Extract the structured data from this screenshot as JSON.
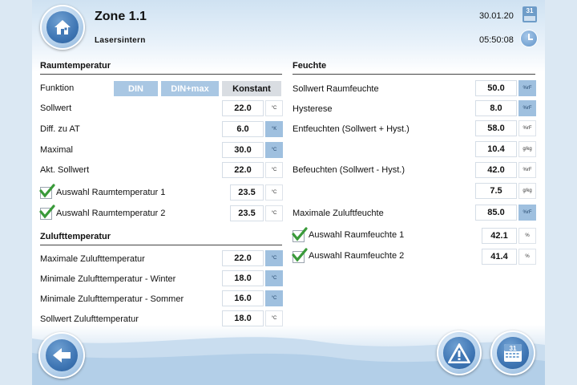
{
  "header": {
    "title": "Zone 1.1",
    "subtitle": "Lasersintern",
    "date": "30.01.20",
    "time": "05:50:08",
    "calendar_day": "31"
  },
  "room_temp": {
    "heading": "Raumtemperatur",
    "function_label": "Funktion",
    "modes": [
      "DIN",
      "DIN+max",
      "Konstant"
    ],
    "active_mode": "Konstant",
    "rows": [
      {
        "label": "Sollwert",
        "value": "22.0",
        "unit": "°C"
      },
      {
        "label": "Diff. zu AT",
        "value": "6.0",
        "unit": "°K"
      },
      {
        "label": "Maximal",
        "value": "30.0",
        "unit": "°C"
      },
      {
        "label": "Akt. Sollwert",
        "value": "22.0",
        "unit": "°C"
      }
    ],
    "selections": [
      {
        "label": "Auswahl Raumtemperatur 1",
        "value": "23.5",
        "unit": "°C",
        "checked": true
      },
      {
        "label": "Auswahl Raumtemperatur 2",
        "value": "23.5",
        "unit": "°C",
        "checked": true
      }
    ]
  },
  "supply_temp": {
    "heading": "Zulufttemperatur",
    "rows": [
      {
        "label": "Maximale Zulufttemperatur",
        "value": "22.0",
        "unit": "°C"
      },
      {
        "label": "Minimale Zulufttemperatur - Winter",
        "value": "18.0",
        "unit": "°C"
      },
      {
        "label": "Minimale Zulufttemperatur - Sommer",
        "value": "16.0",
        "unit": "°C"
      },
      {
        "label": "Sollwert Zulufttemperatur",
        "value": "18.0",
        "unit": "°C"
      }
    ]
  },
  "humidity": {
    "heading": "Feuchte",
    "rows": [
      {
        "label": "Sollwert Raumfeuchte",
        "value": "50.0",
        "unit": "%rF"
      },
      {
        "label": "Hysterese",
        "value": "8.0",
        "unit": "%rF"
      },
      {
        "label": "Entfeuchten (Sollwert + Hyst.)",
        "value": "58.0",
        "unit": "%rF"
      },
      {
        "label": "",
        "value": "10.4",
        "unit": "g/kg"
      },
      {
        "label": "Befeuchten (Sollwert - Hyst.)",
        "value": "42.0",
        "unit": "%rF"
      },
      {
        "label": "",
        "value": "7.5",
        "unit": "g/kg"
      },
      {
        "label": "Maximale Zuluftfeuchte",
        "value": "85.0",
        "unit": "%rF"
      }
    ],
    "selections": [
      {
        "label": "Auswahl Raumfeuchte 1",
        "value": "42.1",
        "unit": "%",
        "checked": true
      },
      {
        "label": "Auswahl Raumfeuchte 2",
        "value": "41.4",
        "unit": "%",
        "checked": true
      }
    ]
  },
  "colors": {
    "accent": "#3f76b4",
    "unit_highlight": "#9fc0df",
    "mode_inactive": "#a9c7e3",
    "mode_active": "#d9dde2"
  },
  "icons": {
    "home": "home-icon",
    "back": "back-arrow-icon",
    "warning": "warning-icon",
    "calendar": "calendar-icon",
    "clock": "clock-icon",
    "check": "checkmark-icon"
  }
}
